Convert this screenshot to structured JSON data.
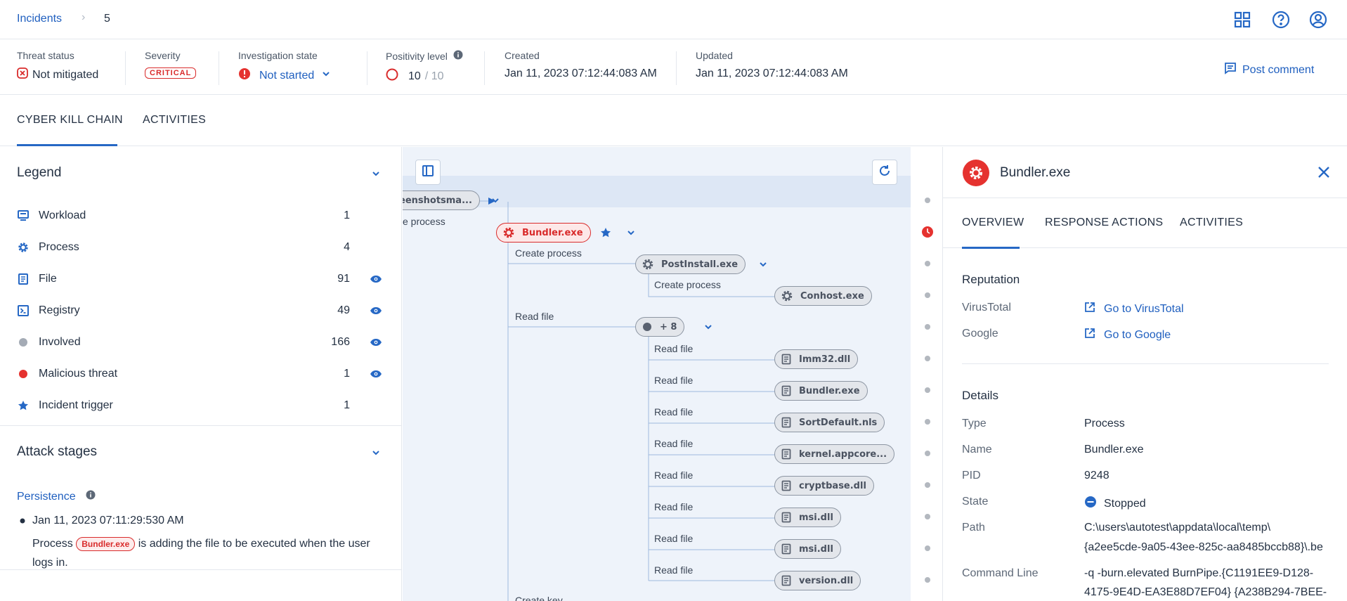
{
  "breadcrumb": {
    "root": "Incidents",
    "separator": "›",
    "current": "5"
  },
  "info": {
    "threat_status": {
      "label": "Threat status",
      "value": "Not mitigated"
    },
    "severity": {
      "label": "Severity",
      "value": "CRITICAL"
    },
    "investigation": {
      "label": "Investigation state",
      "value": "Not started"
    },
    "positivity": {
      "label": "Positivity level",
      "value": "10",
      "max": "/ 10"
    },
    "created": {
      "label": "Created",
      "value": "Jan 11, 2023 07:12:44:083 AM"
    },
    "updated": {
      "label": "Updated",
      "value": "Jan 11, 2023 07:12:44:083 AM"
    },
    "post_comment": "Post comment"
  },
  "tabs": [
    "CYBER KILL CHAIN",
    "ACTIVITIES"
  ],
  "legend": {
    "title": "Legend",
    "items": [
      {
        "label": "Workload",
        "count": "1",
        "icon": "workload-icon"
      },
      {
        "label": "Process",
        "count": "4",
        "icon": "gear-icon"
      },
      {
        "label": "File",
        "count": "91",
        "icon": "file-icon"
      },
      {
        "label": "Registry",
        "count": "49",
        "icon": "registry-icon"
      },
      {
        "label": "Involved",
        "count": "166",
        "icon": "involved-dot-icon"
      },
      {
        "label": "Malicious threat",
        "count": "1",
        "icon": "malicious-dot-icon"
      },
      {
        "label": "Incident trigger",
        "count": "1",
        "icon": "star-icon"
      }
    ]
  },
  "attack_stages": {
    "title": "Attack stages",
    "stage": "Persistence",
    "date": "Jan 11, 2023 07:11:29:530 AM",
    "desc_pre": "Process",
    "desc_process": "Bundler.exe",
    "desc_post": "is adding the file to be executed when the user logs in."
  },
  "graph": {
    "root_node": "eenshotsma...",
    "root_edge": "e process",
    "selected_node": "Bundler.exe",
    "edges": {
      "create_process": "Create process",
      "read_file": "Read file",
      "create_key": "Create key"
    },
    "nodes": {
      "postinstall": "PostInstall.exe",
      "conhost": "Conhost.exe",
      "group": "+ 8",
      "files": [
        "Imm32.dll",
        "Bundler.exe",
        "SortDefault.nls",
        "kernel.appcore...",
        "cryptbase.dll",
        "msi.dll",
        "msi.dll",
        "version.dll"
      ]
    }
  },
  "details_panel": {
    "title": "Bundler.exe",
    "tabs": [
      "OVERVIEW",
      "RESPONSE ACTIONS",
      "ACTIVITIES"
    ],
    "reputation": {
      "title": "Reputation",
      "virustotal_label": "VirusTotal",
      "virustotal_link": "Go to VirusTotal",
      "google_label": "Google",
      "google_link": "Go to Google"
    },
    "details": {
      "title": "Details",
      "type_label": "Type",
      "type": "Process",
      "name_label": "Name",
      "name": "Bundler.exe",
      "pid_label": "PID",
      "pid": "9248",
      "state_label": "State",
      "state": "Stopped",
      "path_label": "Path",
      "path_1": "C:\\users\\autotest\\appdata\\local\\temp\\",
      "path_2": "{a2ee5cde-9a05-43ee-825c-aa8485bccb88}\\.be",
      "cmd_label": "Command Line",
      "cmd_1": "-q -burn.elevated BurnPipe.{C1191EE9-D128-",
      "cmd_2": "4175-9E4D-EA3E88D7EF04} {A238B294-7BEE-"
    }
  },
  "colors": {
    "accent": "#2668c5",
    "danger": "#d92b2b",
    "graph_bg": "#eef3fa"
  }
}
